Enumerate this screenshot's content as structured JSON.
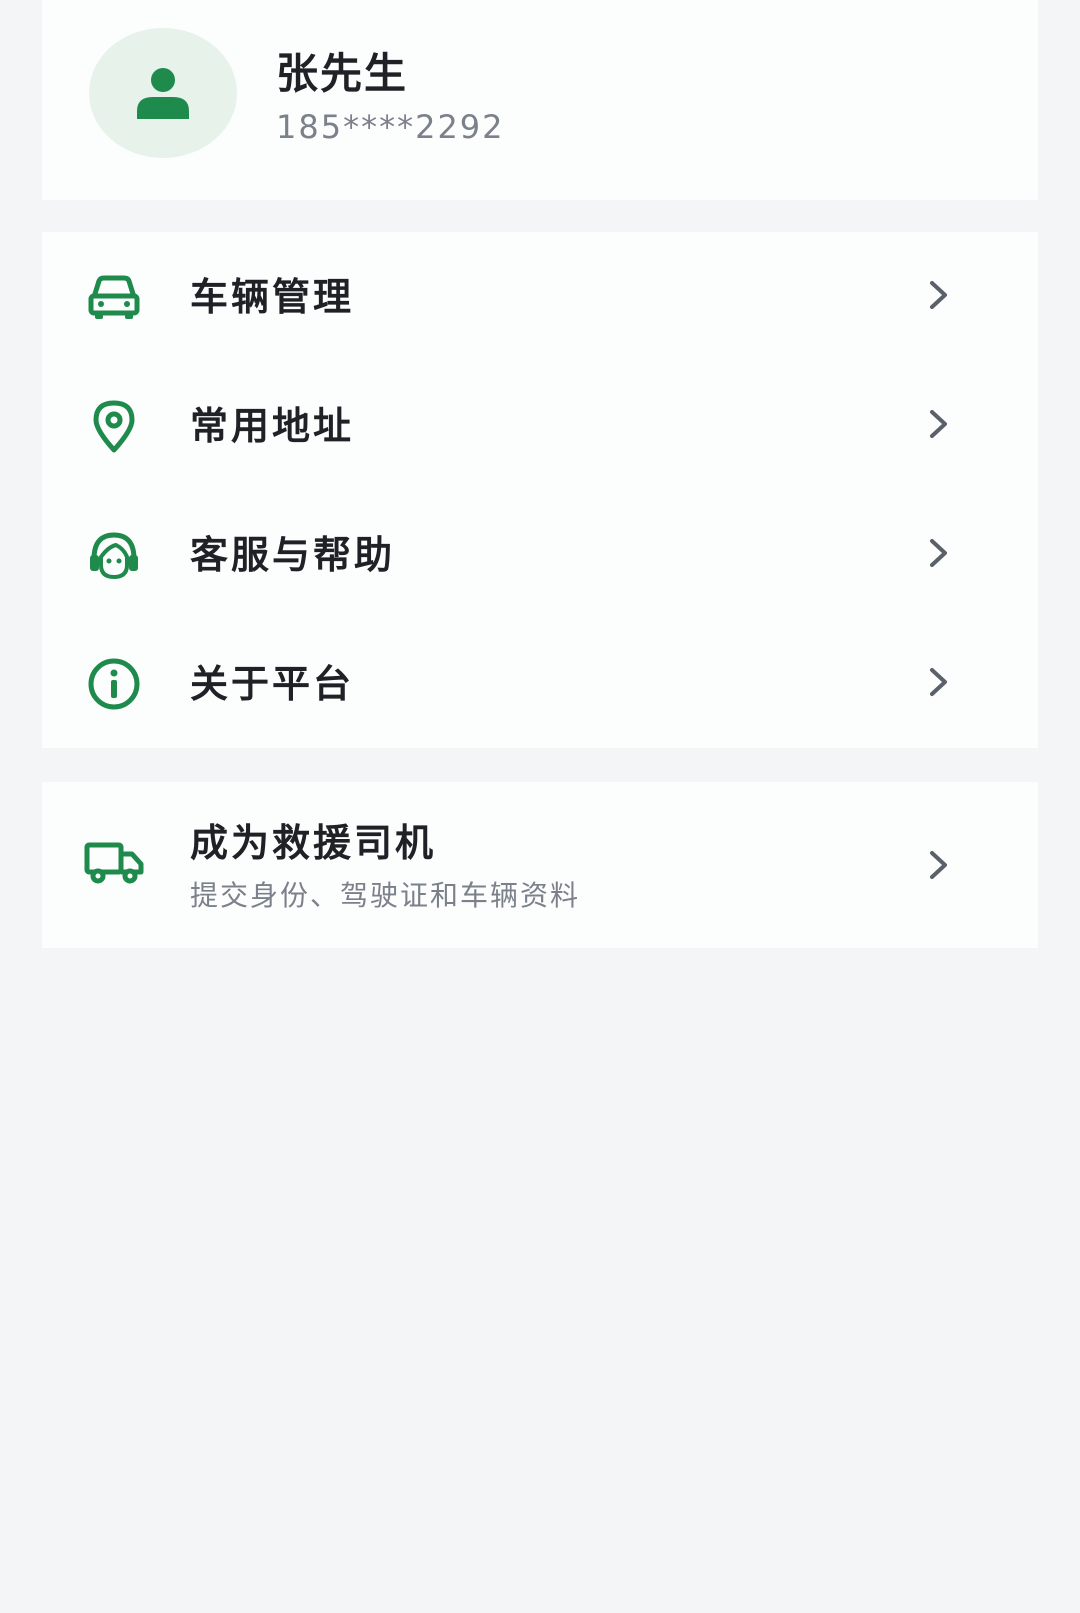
{
  "profile": {
    "name": "张先生",
    "phone": "185****2292",
    "avatar_icon": "person-icon"
  },
  "menu": {
    "items": [
      {
        "label": "车辆管理",
        "icon": "car-icon"
      },
      {
        "label": "常用地址",
        "icon": "location-pin-icon"
      },
      {
        "label": "客服与帮助",
        "icon": "customer-service-icon"
      },
      {
        "label": "关于平台",
        "icon": "info-icon"
      }
    ]
  },
  "driver": {
    "title": "成为救援司机",
    "subtitle": "提交身份、驾驶证和车辆资料",
    "icon": "truck-icon"
  },
  "colors": {
    "accent": "#1e8a4c",
    "avatar_bg": "#e6f2ea",
    "page_bg": "#f3f5f7",
    "card_bg": "#fcfdfd",
    "text_primary": "#1e2126",
    "text_secondary": "#7b818b",
    "chevron": "#5b616b"
  }
}
